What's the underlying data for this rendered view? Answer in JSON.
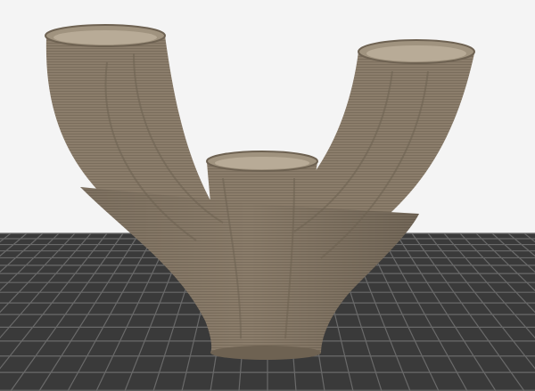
{
  "viewport": {
    "background_color": "#f4f4f4",
    "bed_color": "#3a3a3a",
    "bed_grid_color": "#6a6a6a",
    "model_color": "#8b7d6b",
    "model_shadow_color": "#6e6252",
    "model_highlight_color": "#a99c88",
    "model_interior_color": "#a0937f"
  }
}
